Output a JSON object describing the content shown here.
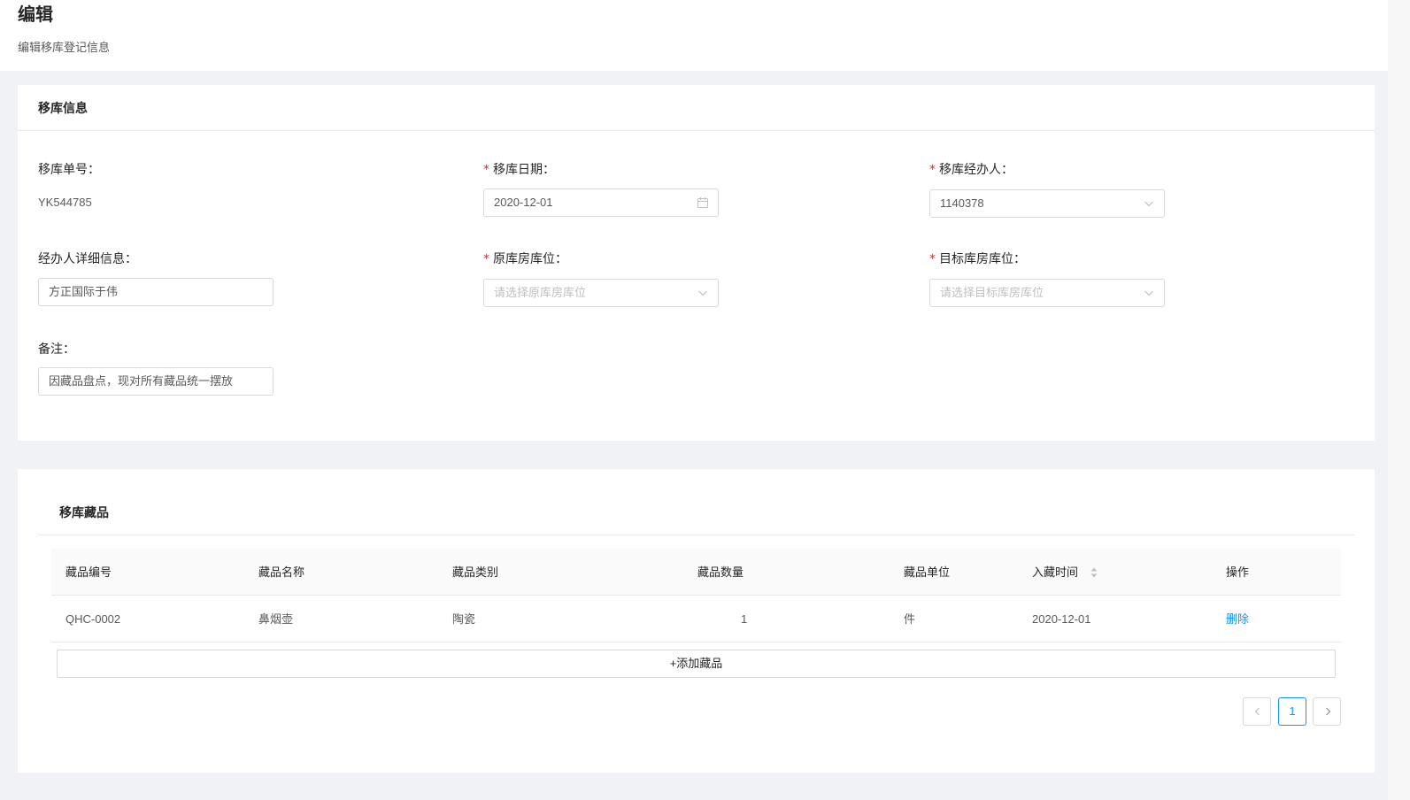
{
  "header": {
    "title": "编辑",
    "subtitle": "编辑移库登记信息"
  },
  "info_card": {
    "title": "移库信息",
    "fields": {
      "order_no": {
        "label": "移库单号：",
        "value": "YK544785"
      },
      "date": {
        "required": "*",
        "label": "移库日期：",
        "value": "2020-12-01",
        "icon": "calendar-icon"
      },
      "handler": {
        "required": "*",
        "label": "移库经办人：",
        "value": "1140378",
        "icon": "chevron-down-icon"
      },
      "handler_detail": {
        "label": "经办人详细信息：",
        "value": "方正国际于伟"
      },
      "source_location": {
        "required": "*",
        "label": "原库房库位：",
        "placeholder": "请选择原库房库位",
        "icon": "chevron-down-icon"
      },
      "target_location": {
        "required": "*",
        "label": "目标库房库位：",
        "placeholder": "请选择目标库房库位",
        "icon": "chevron-down-icon"
      },
      "remark": {
        "label": "备注：",
        "value": "因藏品盘点，现对所有藏品统一摆放"
      }
    }
  },
  "items_card": {
    "title": "移库藏品",
    "columns": [
      "藏品编号",
      "藏品名称",
      "藏品类别",
      "藏品数量",
      "藏品单位",
      "入藏时间",
      "操作"
    ],
    "rows": [
      {
        "code": "QHC-0002",
        "name": "鼻烟壶",
        "category": "陶瓷",
        "quantity": "1",
        "unit": "件",
        "date": "2020-12-01",
        "action": "删除"
      }
    ],
    "add_button": "+添加藏品",
    "pagination": {
      "current": "1"
    }
  },
  "colors": {
    "accent": "#1890ff",
    "required": "#f5222d",
    "background": "#f0f2f5"
  }
}
